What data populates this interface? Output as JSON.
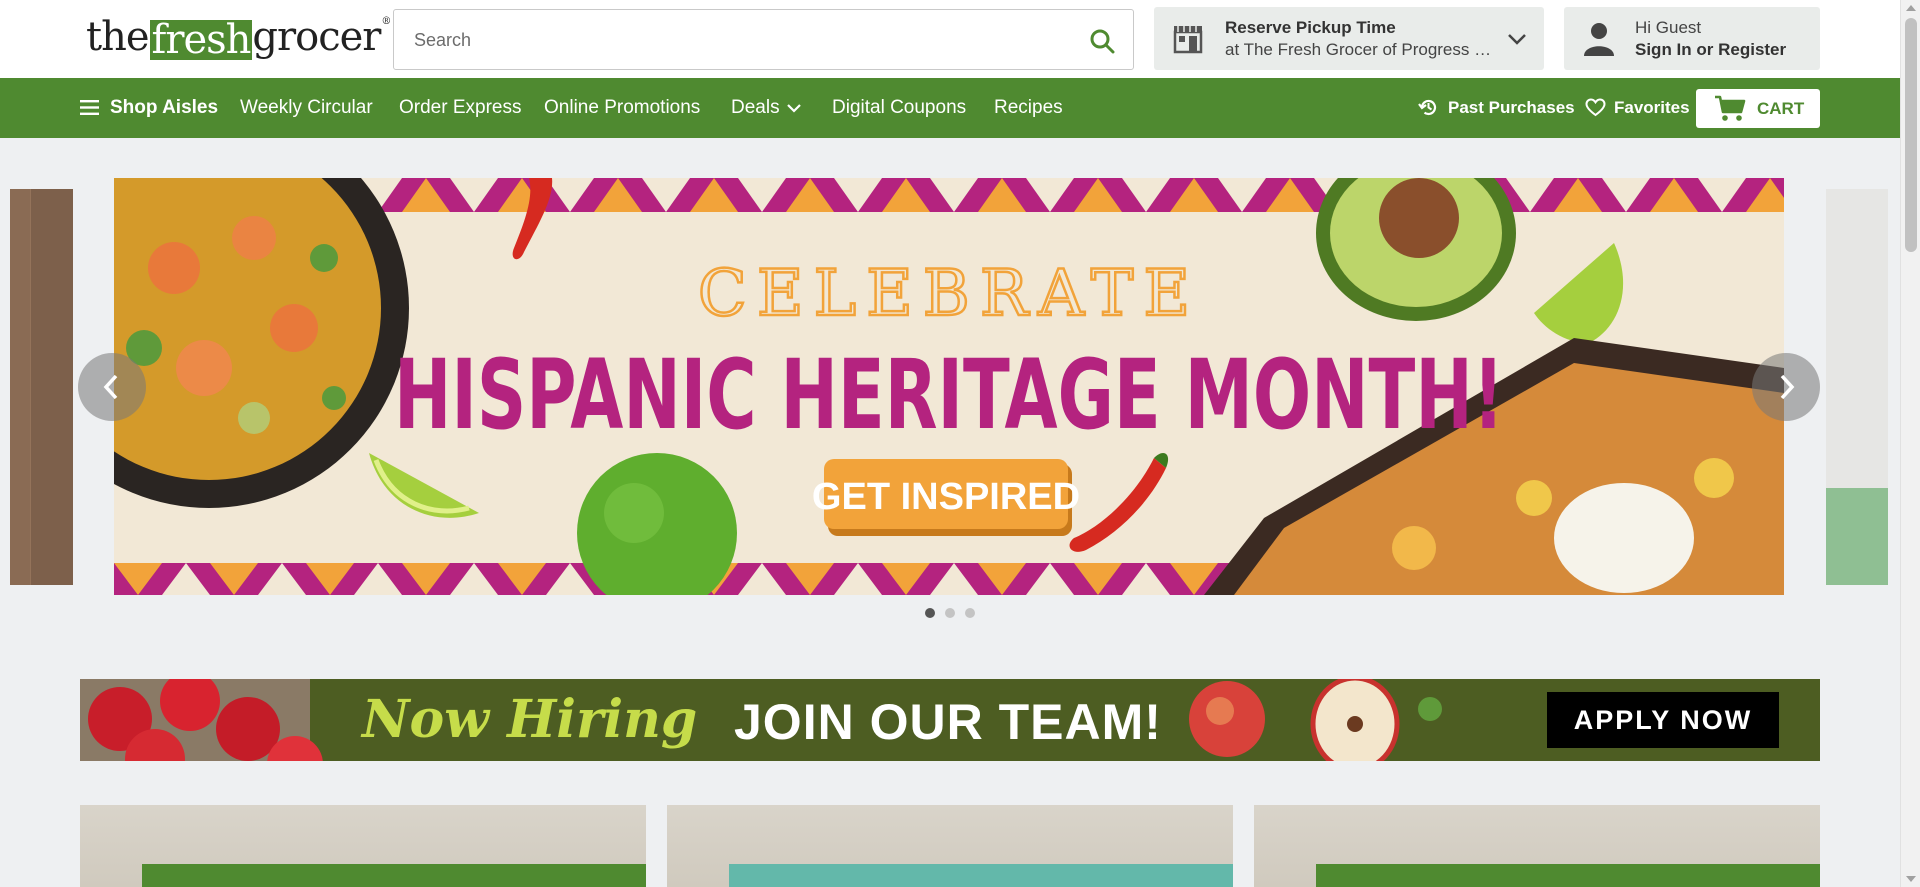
{
  "header": {
    "logo": {
      "the": "the",
      "fresh": "fresh",
      "grocer": "grocer",
      "mark": "®"
    },
    "search": {
      "placeholder": "Search",
      "icon": "search-icon"
    },
    "pickup": {
      "title": "Reserve Pickup Time",
      "store": "at The Fresh Grocer of Progress Plaza",
      "icon": "store-icon"
    },
    "account": {
      "greeting": "Hi Guest",
      "action": "Sign In or Register",
      "icon": "person-icon"
    }
  },
  "nav": {
    "shop_aisles": "Shop Aisles",
    "items": [
      "Weekly Circular",
      "Order Express",
      "Online Promotions",
      "Deals",
      "Digital Coupons",
      "Recipes"
    ],
    "past_purchases": "Past Purchases",
    "favorites": "Favorites",
    "cart": "CART",
    "color": "#4f8a30"
  },
  "hero": {
    "celebrate": "CELEBRATE",
    "headline": "HISPANIC HERITAGE MONTH!",
    "cta": "GET INSPIRED",
    "slides_total": 3,
    "active_slide": 1,
    "colors": {
      "magenta": "#b4237f",
      "orange": "#f2a33a"
    }
  },
  "hiring": {
    "script": "Now Hiring",
    "headline": "JOIN OUR TEAM!",
    "cta": "APPLY NOW"
  }
}
